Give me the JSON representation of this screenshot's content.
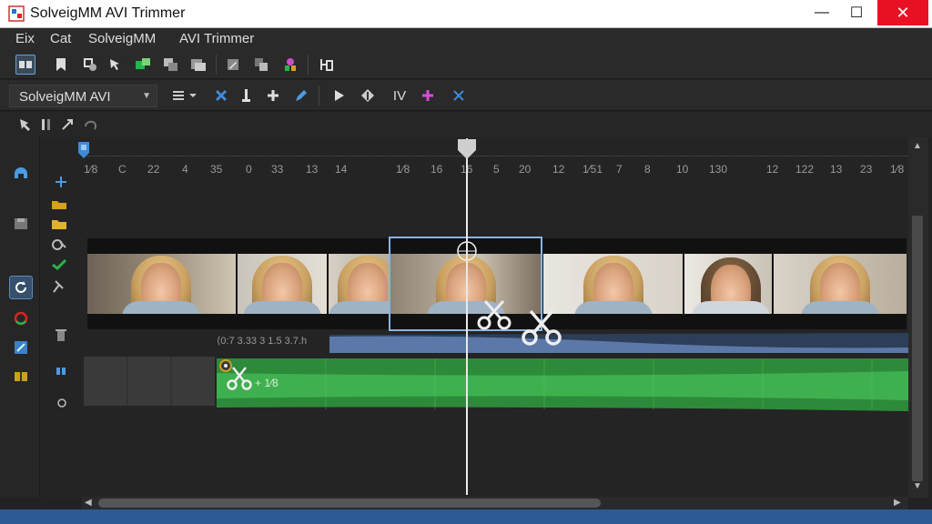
{
  "window": {
    "title": "SolveigMM AVI Trimmer",
    "controls": {
      "minimize": "—",
      "maximize": "☐",
      "close": "✕"
    }
  },
  "menu": [
    "Eix",
    "Cat",
    "SolveigMM",
    "AVI Trimmer"
  ],
  "toolbar2": {
    "combo_value": "SolveigMM AVI",
    "iv_label": "IV"
  },
  "ruler": {
    "ticks": [
      "1⁄8",
      "C",
      "22",
      "4",
      "35",
      "0",
      "33",
      "13",
      "14",
      "1⁄8",
      "16",
      "16",
      "5",
      "20",
      "12",
      "1⁄51",
      "7",
      "8",
      "10",
      "130",
      "12",
      "122",
      "13",
      "23",
      "1⁄8"
    ]
  },
  "timeline": {
    "track_info": "⟨0:7 3.33 3 1.5 3.7.h",
    "audio_label": "+ 1⁄8"
  },
  "colors": {
    "accent": "#8ab4e0",
    "audio_green": "#35a844",
    "video_blue": "#5b78a8",
    "close_red": "#e81123"
  }
}
